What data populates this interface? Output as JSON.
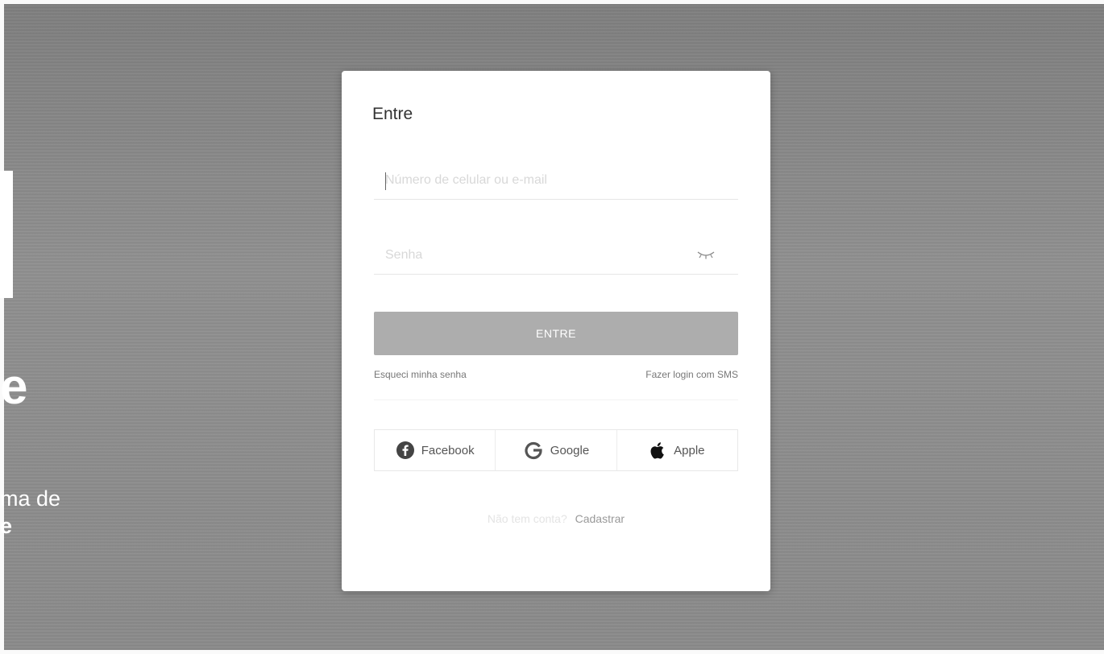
{
  "background": {
    "hero_letter": "e",
    "hero_line1": "ma de",
    "hero_line2": "e"
  },
  "modal": {
    "title": "Entre",
    "username_placeholder": "Número de celular ou e-mail",
    "password_placeholder": "Senha",
    "submit_label": "ENTRE",
    "forgot_password": "Esqueci minha senha",
    "sms_login": "Fazer login com SMS",
    "social": [
      {
        "id": "facebook",
        "label": "Facebook",
        "icon": "facebook-icon",
        "color": "#444444"
      },
      {
        "id": "google",
        "label": "Google",
        "icon": "google-icon",
        "color": "#444444"
      },
      {
        "id": "apple",
        "label": "Apple",
        "icon": "apple-icon",
        "color": "#111111"
      }
    ],
    "signup_prompt": "Não tem conta?",
    "signup_link": "Cadastrar"
  },
  "colors": {
    "backdrop": "#8a8a8a",
    "submit_disabled": "#adadad",
    "modal_bg": "#ffffff"
  }
}
